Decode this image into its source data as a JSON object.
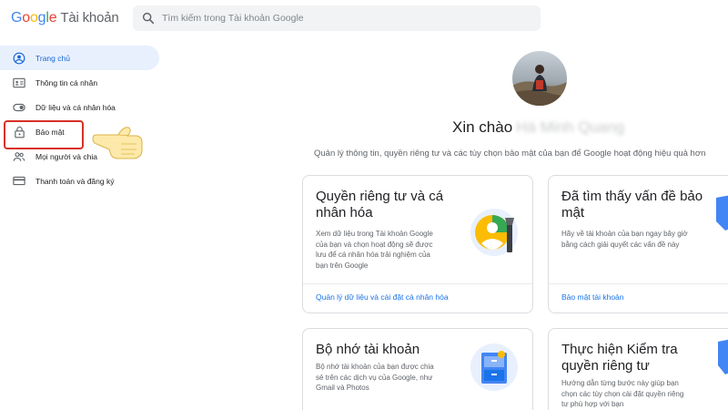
{
  "header": {
    "logo_letters": [
      "G",
      "o",
      "o",
      "g",
      "l",
      "e"
    ],
    "product": "Tài khoản",
    "search_placeholder": "Tìm kiếm trong Tài khoản Google",
    "search_icon": "search-icon"
  },
  "sidebar": {
    "items": [
      {
        "label": "Trang chủ",
        "icon": "home-account-icon",
        "active": true
      },
      {
        "label": "Thông tin cá nhân",
        "icon": "id-card-icon",
        "active": false
      },
      {
        "label": "Dữ liệu và cá nhân hóa",
        "icon": "toggle-icon",
        "active": false
      },
      {
        "label": "Bảo mật",
        "icon": "lock-icon",
        "active": false
      },
      {
        "label": "Mọi người và chia",
        "icon": "people-icon",
        "active": false
      },
      {
        "label": "Thanh toán và đăng ký",
        "icon": "credit-card-icon",
        "active": false
      }
    ],
    "highlight_color": "#d93025",
    "active_color": "#1967d2"
  },
  "main": {
    "greeting": "Xin chào",
    "user_name": "Hà Minh Quang",
    "subtitle": "Quản lý thông tin, quyền riêng tư và các tùy chọn bảo mật của bạn để Google hoạt động hiệu quả hơn",
    "cards": [
      {
        "title_lines": [
          "Quyền riêng tư và cá",
          "nhân hóa"
        ],
        "desc_lines": [
          "Xem dữ liệu trong Tài khoản Google",
          "của bạn và chọn hoạt động sẽ được",
          "lưu để cá nhân hóa trải nghiệm của",
          "bạn trên Google"
        ],
        "link": "Quản lý dữ liệu và cài đặt cá nhân hóa",
        "icon": "privacy-personalization-icon"
      },
      {
        "title_lines": [
          "Đã tìm thấy vấn đề bảo",
          "mật"
        ],
        "desc_lines": [
          "Hãy về tài khoản của bạn ngay bây giờ",
          "bằng cách giải quyết các vấn đề này"
        ],
        "link": "Bảo mật tài khoản",
        "icon": "security-shield-icon"
      },
      {
        "title_lines": [
          "Bộ nhớ tài khoản"
        ],
        "desc_lines": [
          "Bộ nhớ tài khoản của bạn được chia",
          "sẻ trên các dịch vụ của Google, như",
          "Gmail và Photos"
        ],
        "link": "",
        "icon": "storage-cabinet-icon"
      },
      {
        "title_lines": [
          "Thực hiện Kiểm tra",
          "quyền riêng tư"
        ],
        "desc_lines": [
          "Hướng dẫn từng bước này giúp bạn",
          "chọn các tùy chọn cài đặt quyền riêng",
          "tư phù hợp với bạn"
        ],
        "link": "",
        "icon": "privacy-checkup-icon"
      }
    ]
  }
}
